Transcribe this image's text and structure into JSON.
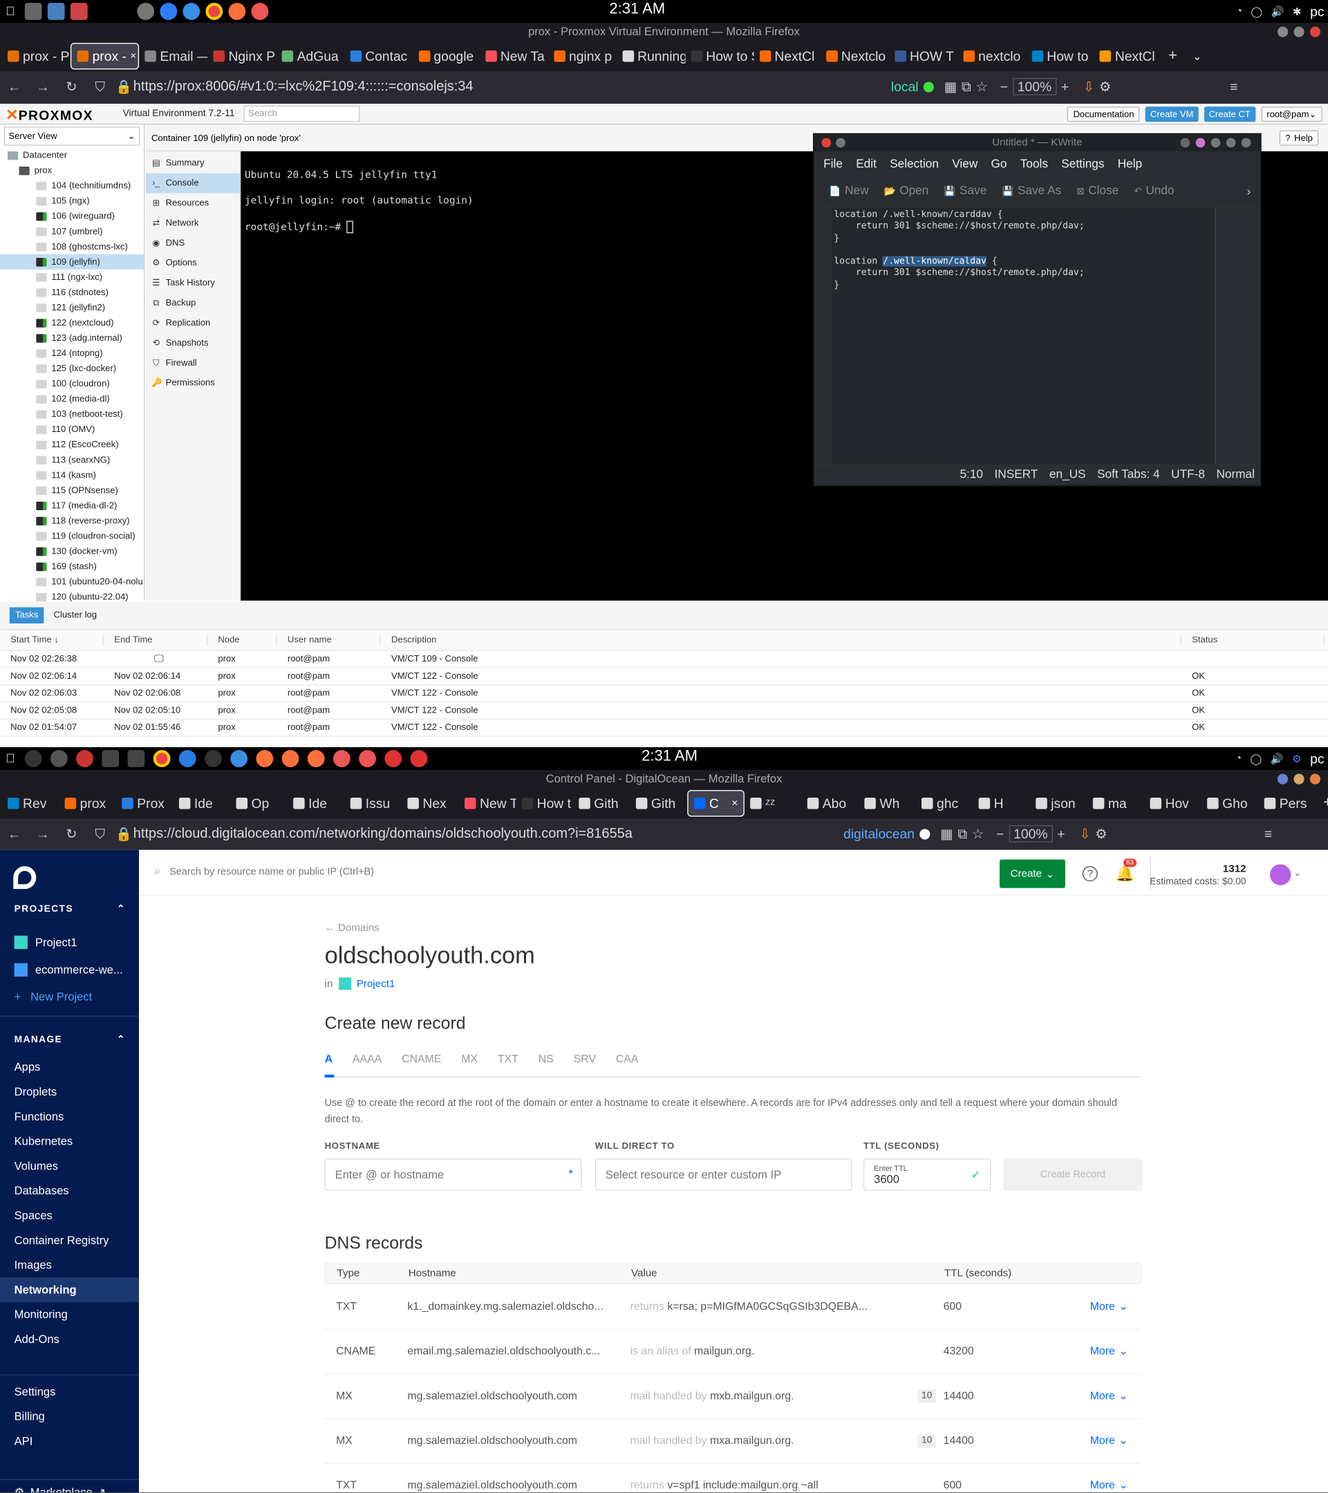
{
  "top_screen": {
    "clock": "2:31 AM",
    "user": "pc",
    "window_title": "prox - Proxmox Virtual Environment — Mozilla Firefox",
    "tabs": [
      {
        "label": "prox - P",
        "color": "#e57000"
      },
      {
        "label": "prox -",
        "color": "#e57000",
        "active": true
      },
      {
        "label": "Email — N",
        "color": "#888888"
      },
      {
        "label": "Nginx P",
        "color": "#cc3333"
      },
      {
        "label": "AdGua",
        "color": "#67b279"
      },
      {
        "label": "Contac",
        "color": "#2a7de1"
      },
      {
        "label": "google",
        "color": "#ff6a00"
      },
      {
        "label": "New Ta",
        "color": "#ff4f5e"
      },
      {
        "label": "nginx p",
        "color": "#ff6a00"
      },
      {
        "label": "Running",
        "color": "#dddddd"
      },
      {
        "label": "How to Se",
        "color": "#333333"
      },
      {
        "label": "NextCl",
        "color": "#ff6a00"
      },
      {
        "label": "Nextclo",
        "color": "#ff6a00"
      },
      {
        "label": "HOW T",
        "color": "#3b5998"
      },
      {
        "label": "nextclo",
        "color": "#ff6a00"
      },
      {
        "label": "How to",
        "color": "#0082c9"
      },
      {
        "label": "NextCl",
        "color": "#ff9900"
      }
    ],
    "url": "https://prox:8006/#v1:0:=lxc%2F109:4::::::=consolejs:34",
    "url_badge": "local",
    "zoom": "100%",
    "proxmox": {
      "logo": "PROXMOX",
      "version": "Virtual Environment 7.2-11",
      "search_placeholder": "Search",
      "documentation": "Documentation",
      "create_vm": "Create VM",
      "create_ct": "Create CT",
      "user": "root@pam",
      "help": "Help",
      "server_view": "Server View",
      "container_title": "Container 109 (jellyfin) on node 'prox'",
      "datacenter": "Datacenter",
      "node": "prox",
      "tree": [
        "104 (technitiumdns)",
        "105 (ngx)",
        "106 (wireguard)",
        "107 (umbrel)",
        "108 (ghostcms-lxc)",
        "109 (jellyfin)",
        "111 (ngx-lxc)",
        "116 (stdnotes)",
        "121 (jellyfin2)",
        "122 (nextcloud)",
        "123 (adg.internal)",
        "124 (ntopng)",
        "125 (lxc-docker)",
        "100 (cloudron)",
        "102 (media-dl)",
        "103 (netboot-test)",
        "110 (OMV)",
        "112 (EscoCreek)",
        "113 (searxNG)",
        "114 (kasm)",
        "115 (OPNsense)",
        "117 (media-dl-2)",
        "118 (reverse-proxy)",
        "119 (cloudron-social)",
        "130 (docker-vm)",
        "169 (stash)",
        "101 (ubuntu20-04-nolu",
        "120 (ubuntu-22.04)"
      ],
      "menu": [
        "Summary",
        "Console",
        "Resources",
        "Network",
        "DNS",
        "Options",
        "Task History",
        "Backup",
        "Replication",
        "Snapshots",
        "Firewall",
        "Permissions"
      ],
      "terminal": [
        "Ubuntu 20.04.5 LTS jellyfin tty1",
        "jellyfin login: root (automatic login)",
        "root@jellyfin:~#"
      ],
      "tasks_tab": "Tasks",
      "cluster_tab": "Cluster log",
      "task_headers": [
        "Start Time ↓",
        "End Time",
        "Node",
        "User name",
        "Description",
        "Status"
      ],
      "task_rows": [
        [
          "Nov 02 02:26:38",
          "",
          "prox",
          "root@pam",
          "VM/CT 109 - Console",
          ""
        ],
        [
          "Nov 02 02:06:14",
          "Nov 02 02:06:14",
          "prox",
          "root@pam",
          "VM/CT 122 - Console",
          "OK"
        ],
        [
          "Nov 02 02:06:03",
          "Nov 02 02:06:08",
          "prox",
          "root@pam",
          "VM/CT 122 - Console",
          "OK"
        ],
        [
          "Nov 02 02:05:08",
          "Nov 02 02:05:10",
          "prox",
          "root@pam",
          "VM/CT 122 - Console",
          "OK"
        ],
        [
          "Nov 02 01:54:07",
          "Nov 02 01:55:46",
          "prox",
          "root@pam",
          "VM/CT 122 - Console",
          "OK"
        ]
      ]
    },
    "kwrite": {
      "title": "Untitled * — KWrite",
      "menu": [
        "File",
        "Edit",
        "Selection",
        "View",
        "Go",
        "Tools",
        "Settings",
        "Help"
      ],
      "toolbar": [
        "New",
        "Open",
        "Save",
        "Save As",
        "Close",
        "Undo"
      ],
      "lines": [
        "location /.well-known/carddav {",
        "    return 301 $scheme://$host/remote.php/dav;",
        "}",
        "",
        "location /.well-known/caldav {",
        "    return 301 $scheme://$host/remote.php/dav;",
        "}"
      ],
      "status": [
        "5:10",
        "INSERT",
        "en_US",
        "Soft Tabs: 4",
        "UTF-8",
        "Normal"
      ]
    }
  },
  "bottom_screen": {
    "clock": "2:31 AM",
    "user": "pc",
    "window_title": "Control Panel - DigitalOcean — Mozilla Firefox",
    "tabs": [
      {
        "label": "Rev",
        "color": "#0082c9"
      },
      {
        "label": "prox",
        "color": "#ff6a00"
      },
      {
        "label": "Prox",
        "color": "#2a7de1"
      },
      {
        "label": "Ide",
        "color": "#dddddd"
      },
      {
        "label": "Op",
        "color": "#dddddd"
      },
      {
        "label": "Ide",
        "color": "#dddddd"
      },
      {
        "label": "Issu",
        "color": "#dddddd"
      },
      {
        "label": "Nex",
        "color": "#dddddd"
      },
      {
        "label": "New T",
        "color": "#ff4f5e"
      },
      {
        "label": "How t",
        "color": "#333333"
      },
      {
        "label": "Gith",
        "color": "#dddddd"
      },
      {
        "label": "Gith",
        "color": "#dddddd"
      },
      {
        "label": "C",
        "color": "#0069ff",
        "active": true
      },
      {
        "label": "ᶻᶻ",
        "color": "#dddddd"
      },
      {
        "label": "Abo",
        "color": "#dddddd"
      },
      {
        "label": "Wh",
        "color": "#dddddd"
      },
      {
        "label": "ghc",
        "color": "#dddddd"
      },
      {
        "label": "H",
        "color": "#dddddd"
      },
      {
        "label": "json",
        "color": "#dddddd"
      },
      {
        "label": "ma",
        "color": "#dddddd"
      },
      {
        "label": "Hov",
        "color": "#dddddd"
      },
      {
        "label": "Gho",
        "color": "#dddddd"
      },
      {
        "label": "Pers",
        "color": "#dddddd"
      }
    ],
    "url": "https://cloud.digitalocean.com/networking/domains/oldschoolyouth.com?i=81655a",
    "url_badge": "digitalocean",
    "zoom": "100%",
    "do": {
      "search_placeholder": "Search by resource name or public IP (Ctrl+B)",
      "create": "Create",
      "notif_count": "63",
      "cost_num": "1312",
      "cost_label": "Estimated costs: $0.00",
      "projects_head": "PROJECTS",
      "projects": [
        "Project1",
        "ecommerce-we..."
      ],
      "new_project": "New Project",
      "manage_head": "MANAGE",
      "manage": [
        "Apps",
        "Droplets",
        "Functions",
        "Kubernetes",
        "Volumes",
        "Databases",
        "Spaces",
        "Container Registry",
        "Images",
        "Networking",
        "Monitoring",
        "Add-Ons"
      ],
      "settings": [
        "Settings",
        "Billing",
        "API"
      ],
      "marketplace": "Marketplace",
      "breadcrumb": "Domains",
      "domain": "oldschoolyouth.com",
      "in_label": "in",
      "project": "Project1",
      "create_record": "Create new record",
      "record_tabs": [
        "A",
        "AAAA",
        "CNAME",
        "MX",
        "TXT",
        "NS",
        "SRV",
        "CAA"
      ],
      "help_text": "Use @ to create the record at the root of the domain or enter a hostname to create it elsewhere. A records are for IPv4 addresses only and tell a request where your domain should direct to.",
      "hostname_label": "HOSTNAME",
      "hostname_placeholder": "Enter @ or hostname",
      "direct_label": "WILL DIRECT TO",
      "direct_placeholder": "Select resource or enter custom IP",
      "ttl_label": "TTL (SECONDS)",
      "ttl_small": "Enter TTL",
      "ttl_value": "3600",
      "create_btn": "Create Record",
      "dns_title": "DNS records",
      "dns_headers": [
        "Type",
        "Hostname",
        "Value",
        "TTL (seconds)"
      ],
      "dns_rows": [
        {
          "type": "TXT",
          "host": "k1._domainkey.mg.salemaziel.oldscho...",
          "prefix": "returns",
          "value": "k=rsa; p=MIGfMA0GCSqGSIb3DQEBA...",
          "prio": "",
          "ttl": "600",
          "more": "More"
        },
        {
          "type": "CNAME",
          "host": "email.mg.salemaziel.oldschoolyouth.c...",
          "prefix": "is an alias of",
          "value": "mailgun.org.",
          "prio": "",
          "ttl": "43200",
          "more": "More"
        },
        {
          "type": "MX",
          "host": "mg.salemaziel.oldschoolyouth.com",
          "prefix": "mail handled by",
          "value": "mxb.mailgun.org.",
          "prio": "10",
          "ttl": "14400",
          "more": "More"
        },
        {
          "type": "MX",
          "host": "mg.salemaziel.oldschoolyouth.com",
          "prefix": "mail handled by",
          "value": "mxa.mailgun.org.",
          "prio": "10",
          "ttl": "14400",
          "more": "More"
        },
        {
          "type": "TXT",
          "host": "mg.salemaziel.oldschoolyouth.com",
          "prefix": "returns",
          "value": "v=spf1 include:mailgun.org ~all",
          "prio": "",
          "ttl": "600",
          "more": "More"
        }
      ]
    }
  }
}
